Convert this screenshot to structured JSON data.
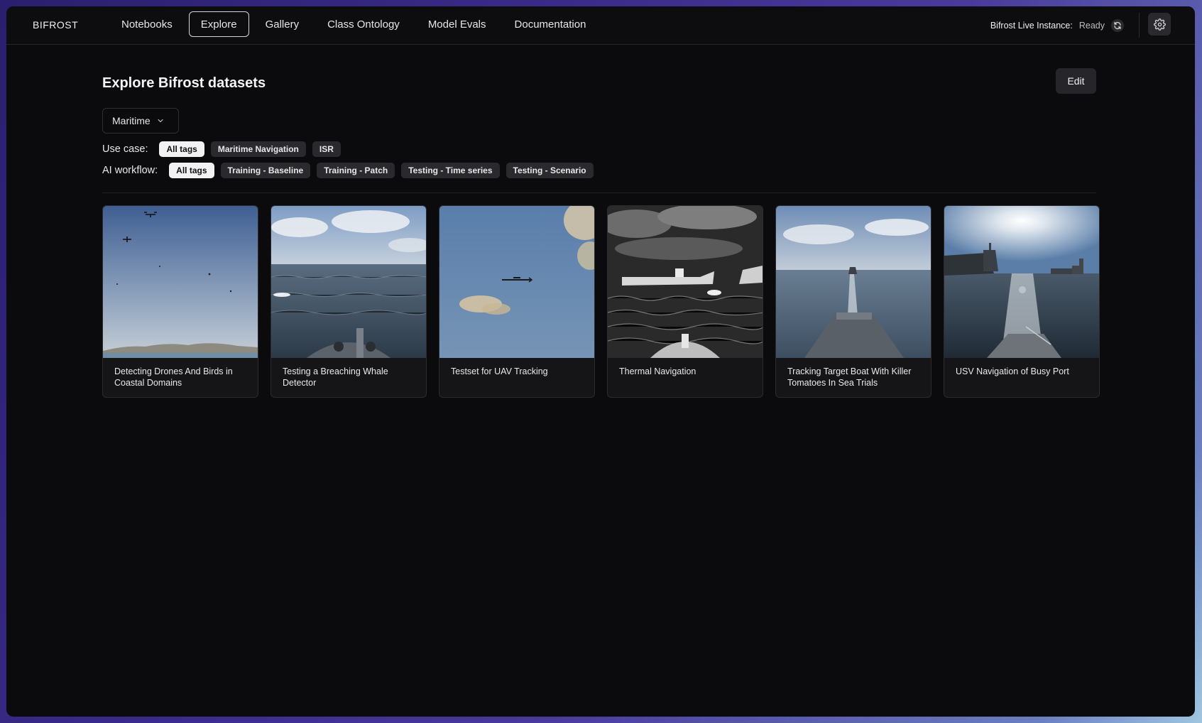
{
  "app": {
    "brand": "BIFROST"
  },
  "nav": {
    "items": [
      {
        "label": "Notebooks",
        "active": false
      },
      {
        "label": "Explore",
        "active": true
      },
      {
        "label": "Gallery",
        "active": false
      },
      {
        "label": "Class Ontology",
        "active": false
      },
      {
        "label": "Model Evals",
        "active": false
      },
      {
        "label": "Documentation",
        "active": false
      }
    ]
  },
  "status": {
    "label": "Bifrost Live Instance:",
    "value": "Ready",
    "icon": "refresh-icon"
  },
  "settings": {
    "icon": "gear-icon"
  },
  "page": {
    "title": "Explore Bifrost datasets",
    "edit_label": "Edit",
    "domain_select": {
      "value": "Maritime",
      "icon": "chevron-down-icon"
    }
  },
  "filters": {
    "use_case": {
      "label": "Use case:",
      "tags": [
        {
          "label": "All tags",
          "active": true
        },
        {
          "label": "Maritime Navigation",
          "active": false
        },
        {
          "label": "ISR",
          "active": false
        }
      ]
    },
    "ai_workflow": {
      "label": "AI workflow:",
      "tags": [
        {
          "label": "All tags",
          "active": true
        },
        {
          "label": "Training - Baseline",
          "active": false
        },
        {
          "label": "Training - Patch",
          "active": false
        },
        {
          "label": "Testing - Time series",
          "active": false
        },
        {
          "label": "Testing - Scenario",
          "active": false
        }
      ]
    }
  },
  "datasets": [
    {
      "title": "Detecting Drones And Birds in Coastal Domains"
    },
    {
      "title": "Testing a Breaching Whale Detector"
    },
    {
      "title": "Testset for UAV Tracking"
    },
    {
      "title": "Thermal Navigation"
    },
    {
      "title": "Tracking Target Boat With Killer Tomatoes In Sea Trials"
    },
    {
      "title": "USV Navigation of Busy Port"
    }
  ]
}
